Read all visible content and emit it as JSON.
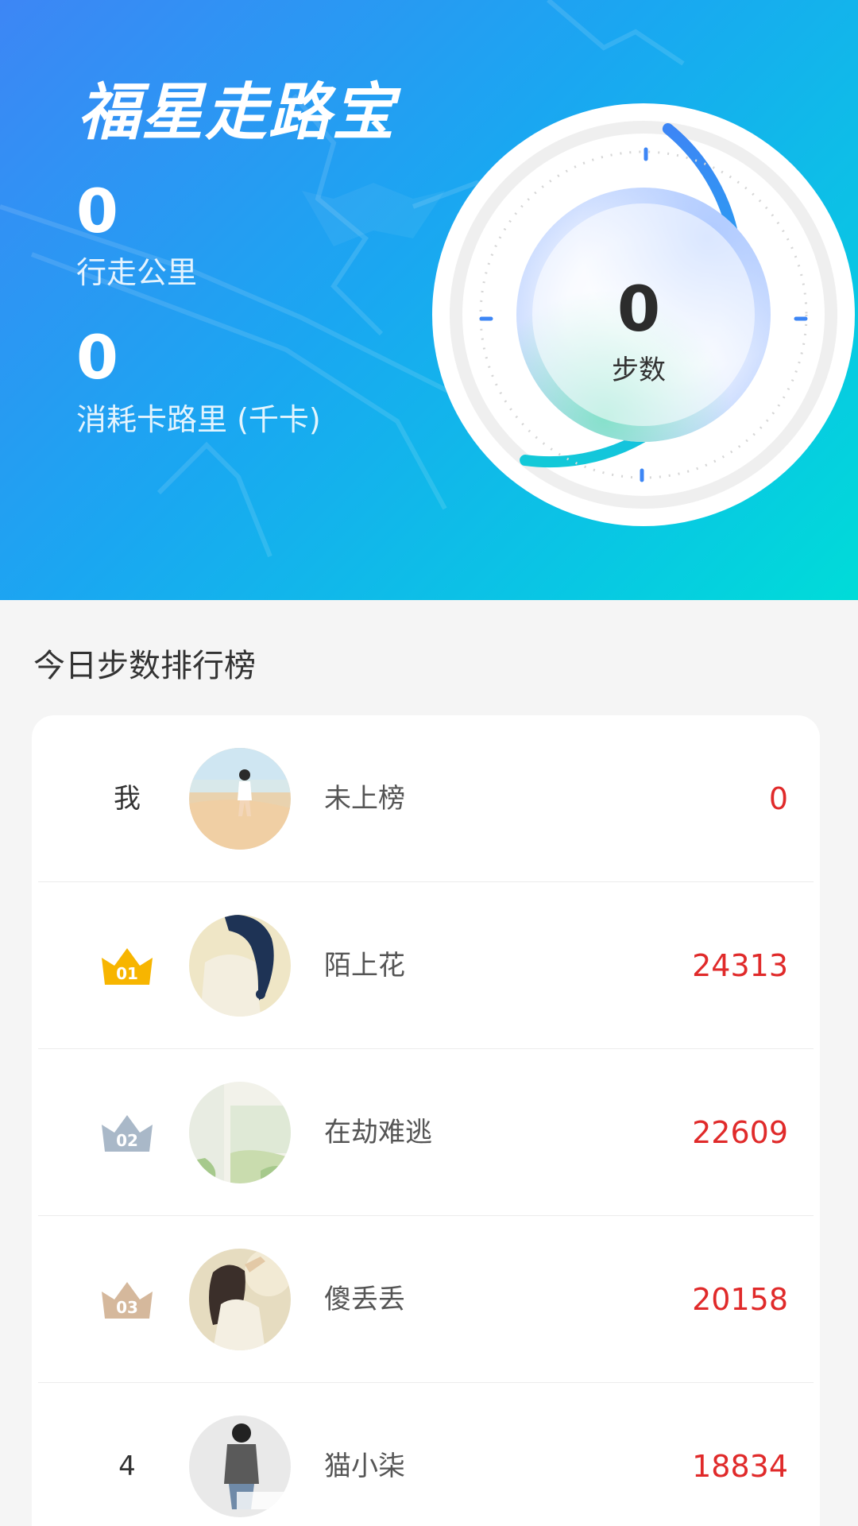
{
  "app_title": "福星走路宝",
  "stats": {
    "distance_value": "0",
    "distance_label": "行走公里",
    "calories_value": "0",
    "calories_label": "消耗卡路里 (千卡)"
  },
  "steps_ring": {
    "value": "0",
    "label": "步数"
  },
  "leaderboard": {
    "title": "今日步数排行榜",
    "rows": [
      {
        "rank": "我",
        "name": "未上榜",
        "steps": "0",
        "avatar": "avatar-beach"
      },
      {
        "rank": "01",
        "name": "陌上花",
        "steps": "24313",
        "avatar": "avatar-braid",
        "medal": "gold"
      },
      {
        "rank": "02",
        "name": "在劫难逃",
        "steps": "22609",
        "avatar": "avatar-window",
        "medal": "silver"
      },
      {
        "rank": "03",
        "name": "傻丢丢",
        "steps": "20158",
        "avatar": "avatar-girl-hat",
        "medal": "bronze"
      },
      {
        "rank": "4",
        "name": "猫小柒",
        "steps": "18834",
        "avatar": "avatar-grey-top"
      }
    ]
  },
  "colors": {
    "hero_start": "#3d86f5",
    "hero_end": "#00dcd8",
    "steps_red": "#e02a2a",
    "gold": "#f7b500",
    "silver": "#a9b8c8",
    "bronze": "#d5b89c"
  }
}
